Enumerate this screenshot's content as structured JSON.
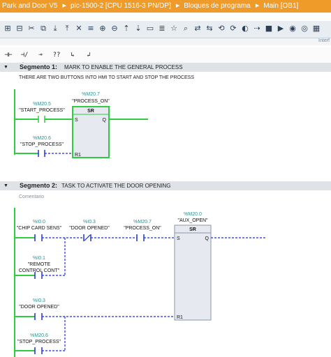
{
  "breadcrumb": {
    "items": [
      "Park and Door V5",
      "plc-1500-2 [CPU 1516-3 PN/DP]",
      "Bloques de programa",
      "Main [OB1]"
    ],
    "separator": "▶"
  },
  "toolbar": {
    "icons": [
      "go-online-icon",
      "go-offline-icon",
      "monitor-icon",
      "compare-icon",
      "download-icon",
      "upload-icon",
      "delete-icon",
      "insert-network-icon",
      "bookmark-icon",
      "move-up-icon",
      "move-down-icon",
      "absolute-address-icon",
      "symbolic-address-icon",
      "comment-icon",
      "favorites-icon",
      "zoom-icon",
      "cross-reference-icon",
      "call-icon",
      "open-block-icon",
      "refresh-icon",
      "breakpoint-icon",
      "step-icon",
      "stop-icon",
      "run-icon",
      "watch-icon",
      "glasses-icon",
      "grid-icon"
    ],
    "glyphs": [
      "⊞",
      "⊟",
      "✂",
      "⧉",
      "⤓",
      "⤒",
      "✕",
      "≡",
      "⊕",
      "⊖",
      "⇡",
      "⇣",
      "▭",
      "≣",
      "☆",
      "⌕",
      "⇄",
      "⇆",
      "⟲",
      "⟳",
      "◐",
      "⇢",
      "■",
      "▶",
      "◉",
      "◎",
      "▦"
    ]
  },
  "interface_label": "Interf",
  "ladder_palette": [
    {
      "name": "no-contact-button",
      "glyph": "⊣⊢"
    },
    {
      "name": "nc-contact-button",
      "glyph": "⊣/⊢"
    },
    {
      "name": "coil-button",
      "glyph": "⊸"
    },
    {
      "name": "empty-box-button",
      "glyph": "??"
    },
    {
      "name": "open-branch-button",
      "glyph": "↳"
    },
    {
      "name": "close-branch-button",
      "glyph": "↲"
    }
  ],
  "segments": [
    {
      "label": "Segmento 1:",
      "title": "MARK TO ENABLE THE GENERAL PROCESS",
      "comment": "THERE ARE TWO BUTTONS INTO HMI TO START AND STOP THE PROCESS",
      "block": {
        "type": "SR",
        "address": "%M20.7",
        "symbol": "\"PROCESS_ON\"",
        "set_pin": "S",
        "reset_pin": "R1",
        "out_pin": "Q"
      },
      "contacts": [
        {
          "address": "%M20.5",
          "symbol": "\"START_PROCESS\""
        },
        {
          "address": "%M20.6",
          "symbol": "\"STOP_PROCESS\""
        }
      ]
    },
    {
      "label": "Segmento 2:",
      "title": "TASK TO ACTIVATE THE DOOR OPENING",
      "comment": "Comentario",
      "block": {
        "type": "SR",
        "address": "%M20.0",
        "symbol": "\"AUX_OPEN\"",
        "set_pin": "S",
        "reset_pin": "R1",
        "out_pin": "Q"
      },
      "contacts": [
        {
          "address": "%I0.0",
          "symbol": "\"CHIP CARD SENS\""
        },
        {
          "address": "%I0.3",
          "symbol": "\"DOOR OPENED\""
        },
        {
          "address": "%M20.7",
          "symbol": "\"PROCESS_ON\""
        },
        {
          "address": "%I0.1",
          "symbol": "\"REMOTE",
          "symbol2": "CONTROL CONT\""
        },
        {
          "address": "%I0.3",
          "symbol": "\"DOOR OPENED\""
        },
        {
          "address": "%M20.6",
          "symbol": "\"STOP_PROCESS\""
        }
      ]
    }
  ],
  "colors": {
    "titlebar": "#ee9b2a",
    "address": "#2a8f8f",
    "energized": "#2ecc40",
    "dashed": "#1e2fd6",
    "block_fill": "#e6eaf0"
  }
}
